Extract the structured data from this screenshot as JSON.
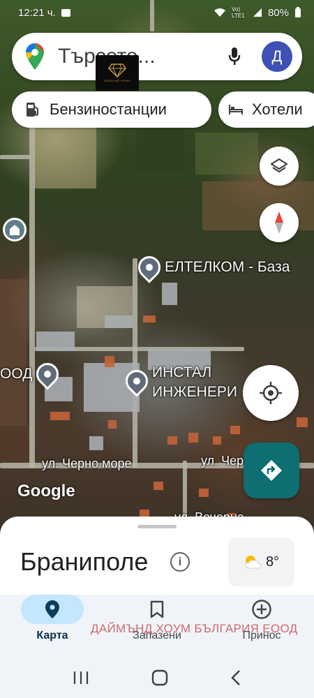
{
  "status_bar": {
    "time": "12:21 ч.",
    "lte": "Vo) LTE1",
    "battery": "80%"
  },
  "search": {
    "placeholder": "Търсете...",
    "avatar_letter": "Д"
  },
  "logo_badge": {
    "text": "DIAMOND HOME"
  },
  "chips": [
    {
      "label": "Бензиностанции",
      "icon": "gas-station-icon"
    },
    {
      "label": "Хотели",
      "icon": "bed-icon"
    }
  ],
  "markers": {
    "eltelkom": "ЕЛТЕЛКОМ - База",
    "ood": "ООД",
    "instal": [
      "ИНСТАЛ",
      "ИНЖЕНЕРИ"
    ]
  },
  "streets": {
    "cherno_more_1": "ул. Черно море",
    "cherno_more_2": "ул. Чер",
    "bottom": "ул. Вечерна"
  },
  "map": {
    "attribution": "Google"
  },
  "place": {
    "name": "Браниполе",
    "weather_temp": "8°"
  },
  "bottom_nav": [
    {
      "label": "Карта",
      "active": true
    },
    {
      "label": "Запазени",
      "active": false
    },
    {
      "label": "Принос",
      "active": false
    }
  ],
  "watermark": "ДАЙМЪНД ХОУМ БЪЛГАРИЯ ЕООД",
  "colors": {
    "accent": "#0e6e71",
    "avatar": "#3f51b5",
    "active_tab": "#c2e7ff"
  }
}
